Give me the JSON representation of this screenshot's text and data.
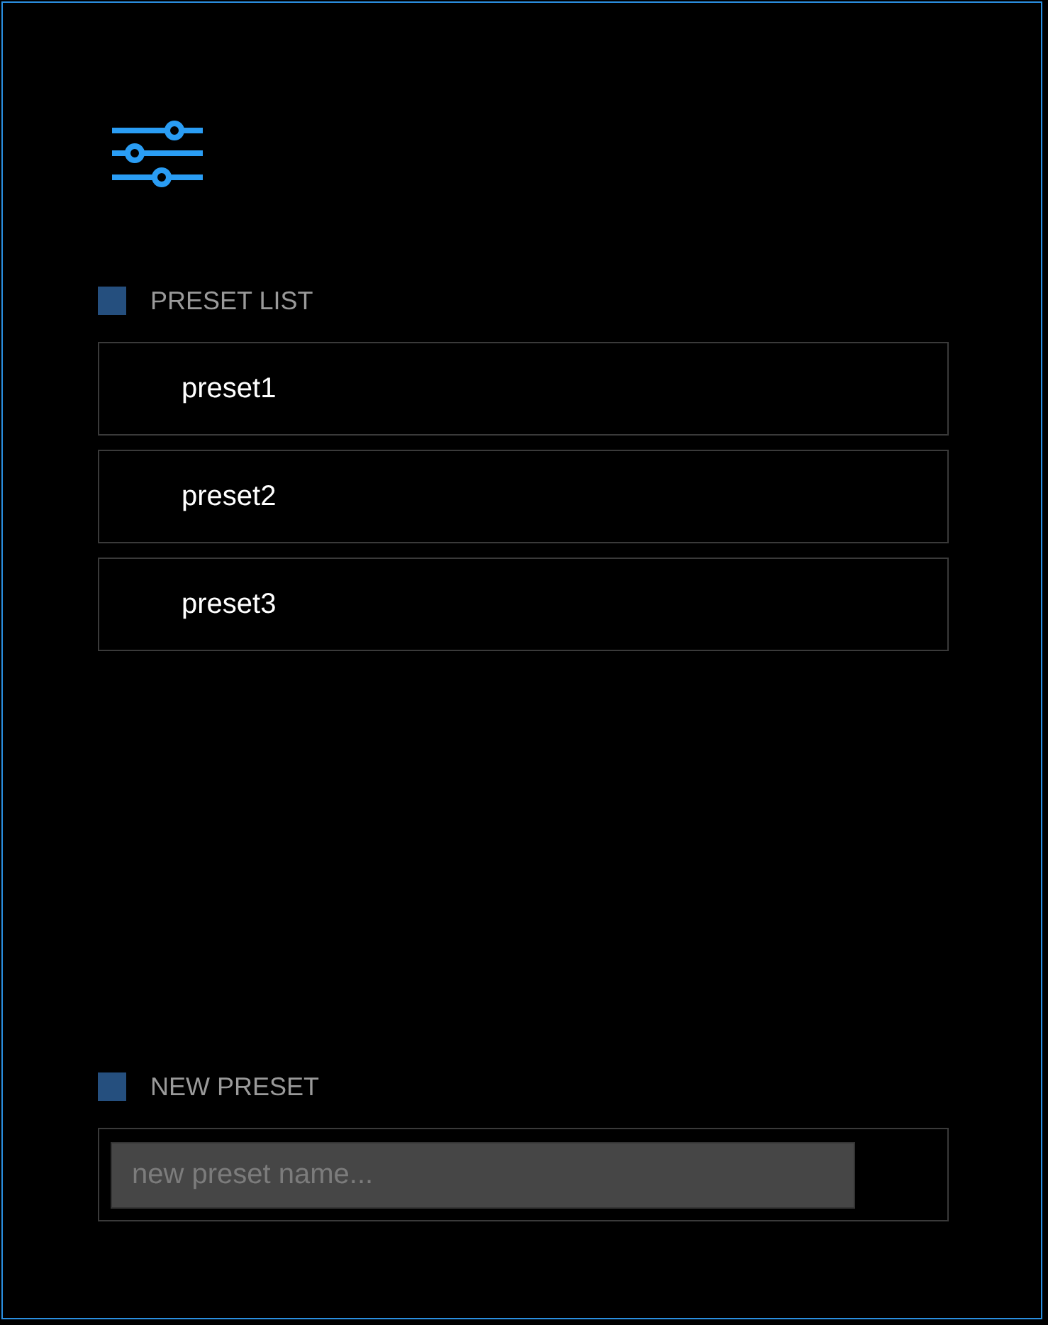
{
  "preset_list": {
    "title": "PRESET LIST",
    "items": [
      {
        "label": "preset1"
      },
      {
        "label": "preset2"
      },
      {
        "label": "preset3"
      }
    ]
  },
  "new_preset": {
    "title": "NEW PRESET",
    "placeholder": "new preset name..."
  }
}
